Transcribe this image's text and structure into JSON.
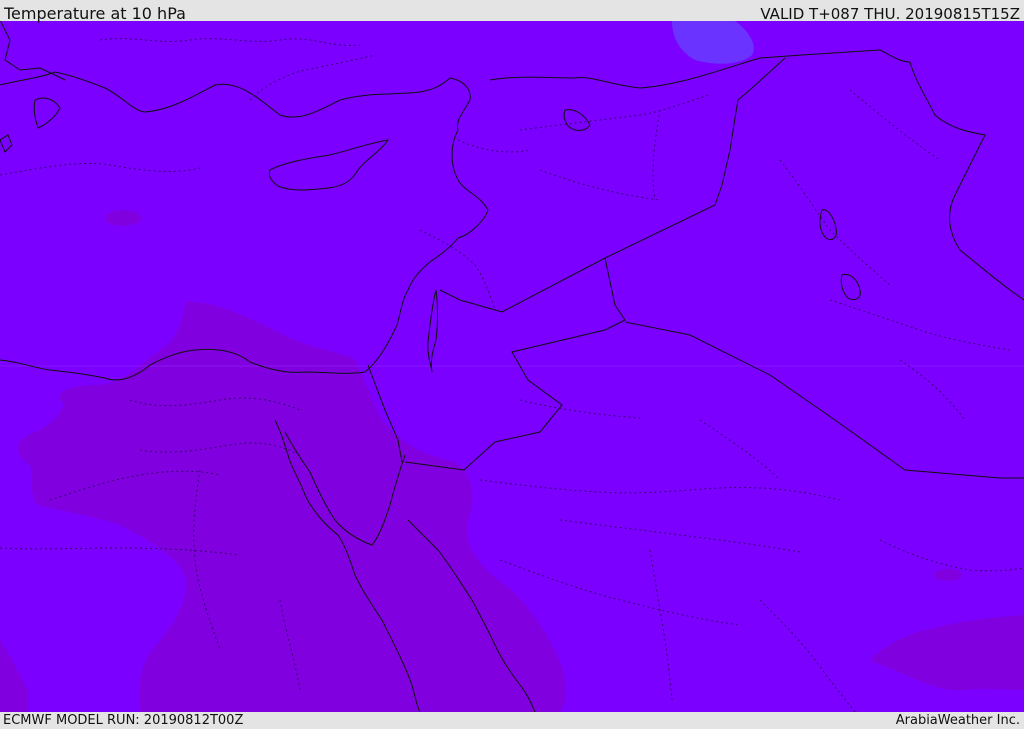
{
  "header": {
    "title": "Temperature at 10 hPa",
    "valid_time": "VALID T+087 THU. 20190815T15Z"
  },
  "footer": {
    "model_run": "ECMWF MODEL RUN: 20190812T00Z",
    "credit": "ArabiaWeather Inc."
  },
  "colors": {
    "field_base": "#7B00FF",
    "field_warm_band": "#8000DF",
    "field_cool_spot": "#6A33FF",
    "coastline": "#111111",
    "border_dotted": "#3a0070",
    "bar_background": "#e4e4e4"
  }
}
